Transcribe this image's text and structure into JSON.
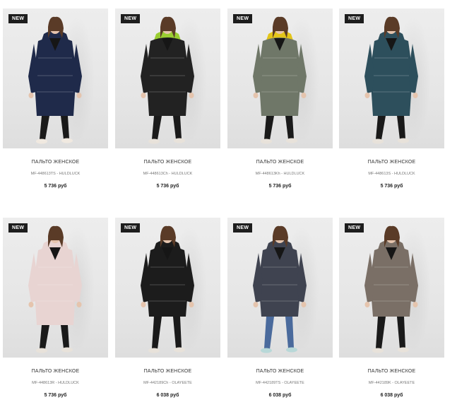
{
  "products": [
    {
      "badge": "NEW",
      "title": "ПАЛЬТО ЖЕНСКОЕ",
      "sku": "MF-448613TS - HULDLUCK",
      "price": "5 736 руб",
      "coat_color": "#1f2a4a",
      "hood_color": "#1f2a4a",
      "pants_color": "#1a1a1a",
      "shoe_color": "#f0e9e0"
    },
    {
      "badge": "NEW",
      "title": "ПАЛЬТО ЖЕНСКОЕ",
      "sku": "MF-448613Ch - HULDLUCK",
      "price": "5 736 руб",
      "coat_color": "#222222",
      "hood_color": "#9acd32",
      "pants_color": "#1a1a1a",
      "shoe_color": "#e8e2da"
    },
    {
      "badge": "NEW",
      "title": "ПАЛЬТО ЖЕНСКОЕ",
      "sku": "MF-448613Kh - HULDLUCK",
      "price": "5 736 руб",
      "coat_color": "#6f7768",
      "hood_color": "#e3c51a",
      "pants_color": "#1a1a1a",
      "shoe_color": "#e8e2da"
    },
    {
      "badge": "NEW",
      "title": "ПАЛЬТО ЖЕНСКОЕ",
      "sku": "MF-448613S - HULDLUCK",
      "price": "5 736 руб",
      "coat_color": "#2d4f5c",
      "hood_color": "#2d4f5c",
      "pants_color": "#1a1a1a",
      "shoe_color": "#e8e2da"
    },
    {
      "badge": "NEW",
      "title": "ПАЛЬТО ЖЕНСКОЕ",
      "sku": "MF-448613R - HULDLUCK",
      "price": "5 736 руб",
      "coat_color": "#e8d4d2",
      "hood_color": "#e8d4d2",
      "pants_color": "#1a1a1a",
      "shoe_color": "#e8e2da"
    },
    {
      "badge": "NEW",
      "title": "ПАЛЬТО ЖЕНСКОЕ",
      "sku": "MF-442189Ch - OLAYEETE",
      "price": "6 038 руб",
      "coat_color": "#1c1c1c",
      "hood_color": "#1c1c1c",
      "pants_color": "#1a1a1a",
      "shoe_color": "#e8e2da"
    },
    {
      "badge": "NEW",
      "title": "ПАЛЬТО ЖЕНСКОЕ",
      "sku": "MF-442189TS - OLAYEETE",
      "price": "6 038 руб",
      "coat_color": "#3f4350",
      "hood_color": "#3f4350",
      "pants_color": "#4a6a9c",
      "shoe_color": "#b8d8d8"
    },
    {
      "badge": "NEW",
      "title": "ПАЛЬТО ЖЕНСКОЕ",
      "sku": "MF-442189K - OLAYEETE",
      "price": "6 038 руб",
      "coat_color": "#7a6f66",
      "hood_color": "#7a6f66",
      "pants_color": "#1a1a1a",
      "shoe_color": "#e8e2da"
    }
  ]
}
